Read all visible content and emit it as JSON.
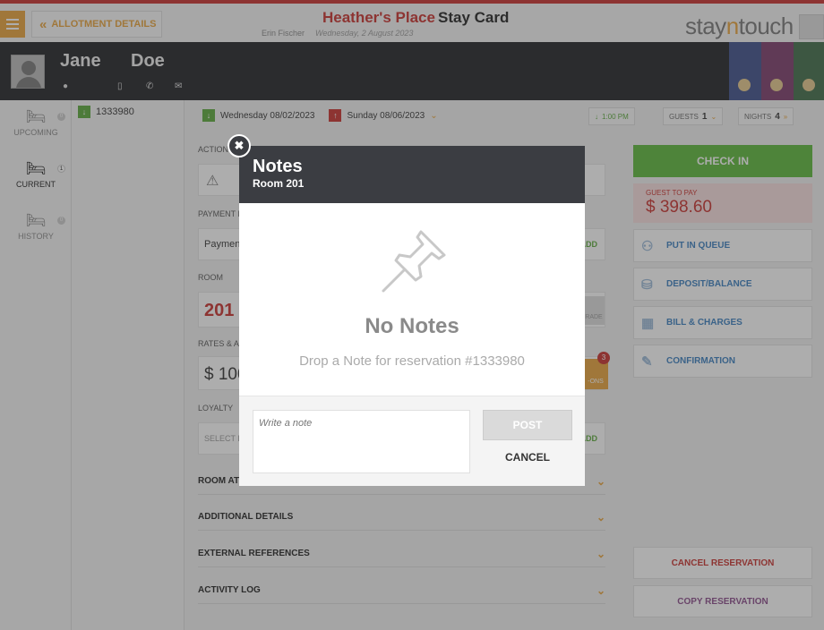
{
  "header": {
    "allotment_label": "ALLOTMENT DETAILS",
    "hotel_name": "Heather's Place",
    "card_title": "Stay Card",
    "user": "Erin Fischer",
    "date": "Wednesday, 2 August 2023",
    "logo_prefix": "stay",
    "logo_mid": "n",
    "logo_suffix": "touch"
  },
  "guest": {
    "first_name": "Jane",
    "last_name": "Doe"
  },
  "nav": {
    "upcoming": {
      "label": "UPCOMING",
      "count": "0"
    },
    "current": {
      "label": "CURRENT",
      "count": "1"
    },
    "history": {
      "label": "HISTORY",
      "count": "0"
    }
  },
  "reservation": {
    "number": "1333980",
    "arrival": "Wednesday 08/02/2023",
    "departure": "Sunday 08/06/2023",
    "time": "1:00 PM",
    "guests_label": "GUESTS",
    "guests": "1",
    "nights_label": "NIGHTS",
    "nights": "4"
  },
  "sections": {
    "actions": "ACTION",
    "payment": "PAYMENT M",
    "payment_value": "Paymen",
    "room": "ROOM",
    "room_value": "201",
    "rates": "RATES & AD",
    "rate_value": "$ 100",
    "loyalty": "LOYALTY",
    "loyalty_value": "SELECT L",
    "add": "ADD",
    "upgrade": "RADE",
    "addons": "-ONS",
    "addons_count": "3",
    "room_att": "ROOM AT",
    "additional": "ADDITIONAL DETAILS",
    "external": "EXTERNAL REFERENCES",
    "activity": "ACTIVITY LOG"
  },
  "right": {
    "check_in": "CHECK IN",
    "guest_to_pay": "GUEST TO PAY",
    "amount": "$ 398.60",
    "queue": "PUT IN QUEUE",
    "deposit": "DEPOSIT/BALANCE",
    "bill": "BILL & CHARGES",
    "confirmation": "CONFIRMATION",
    "cancel_res": "CANCEL RESERVATION",
    "copy_res": "COPY RESERVATION"
  },
  "modal": {
    "title": "Notes",
    "subtitle": "Room 201",
    "empty_title": "No Notes",
    "empty_text": "Drop a Note for reservation #1333980",
    "placeholder": "Write a note",
    "post": "POST",
    "cancel": "CANCEL"
  },
  "colors": {
    "accent": "#e8a33a",
    "danger": "#c9302c",
    "success": "#5cb83a",
    "modal_header": "#3b3d42",
    "tab_blue": "#3d4f8a",
    "tab_magenta": "#7a3a6a",
    "tab_green": "#3f6b48"
  }
}
